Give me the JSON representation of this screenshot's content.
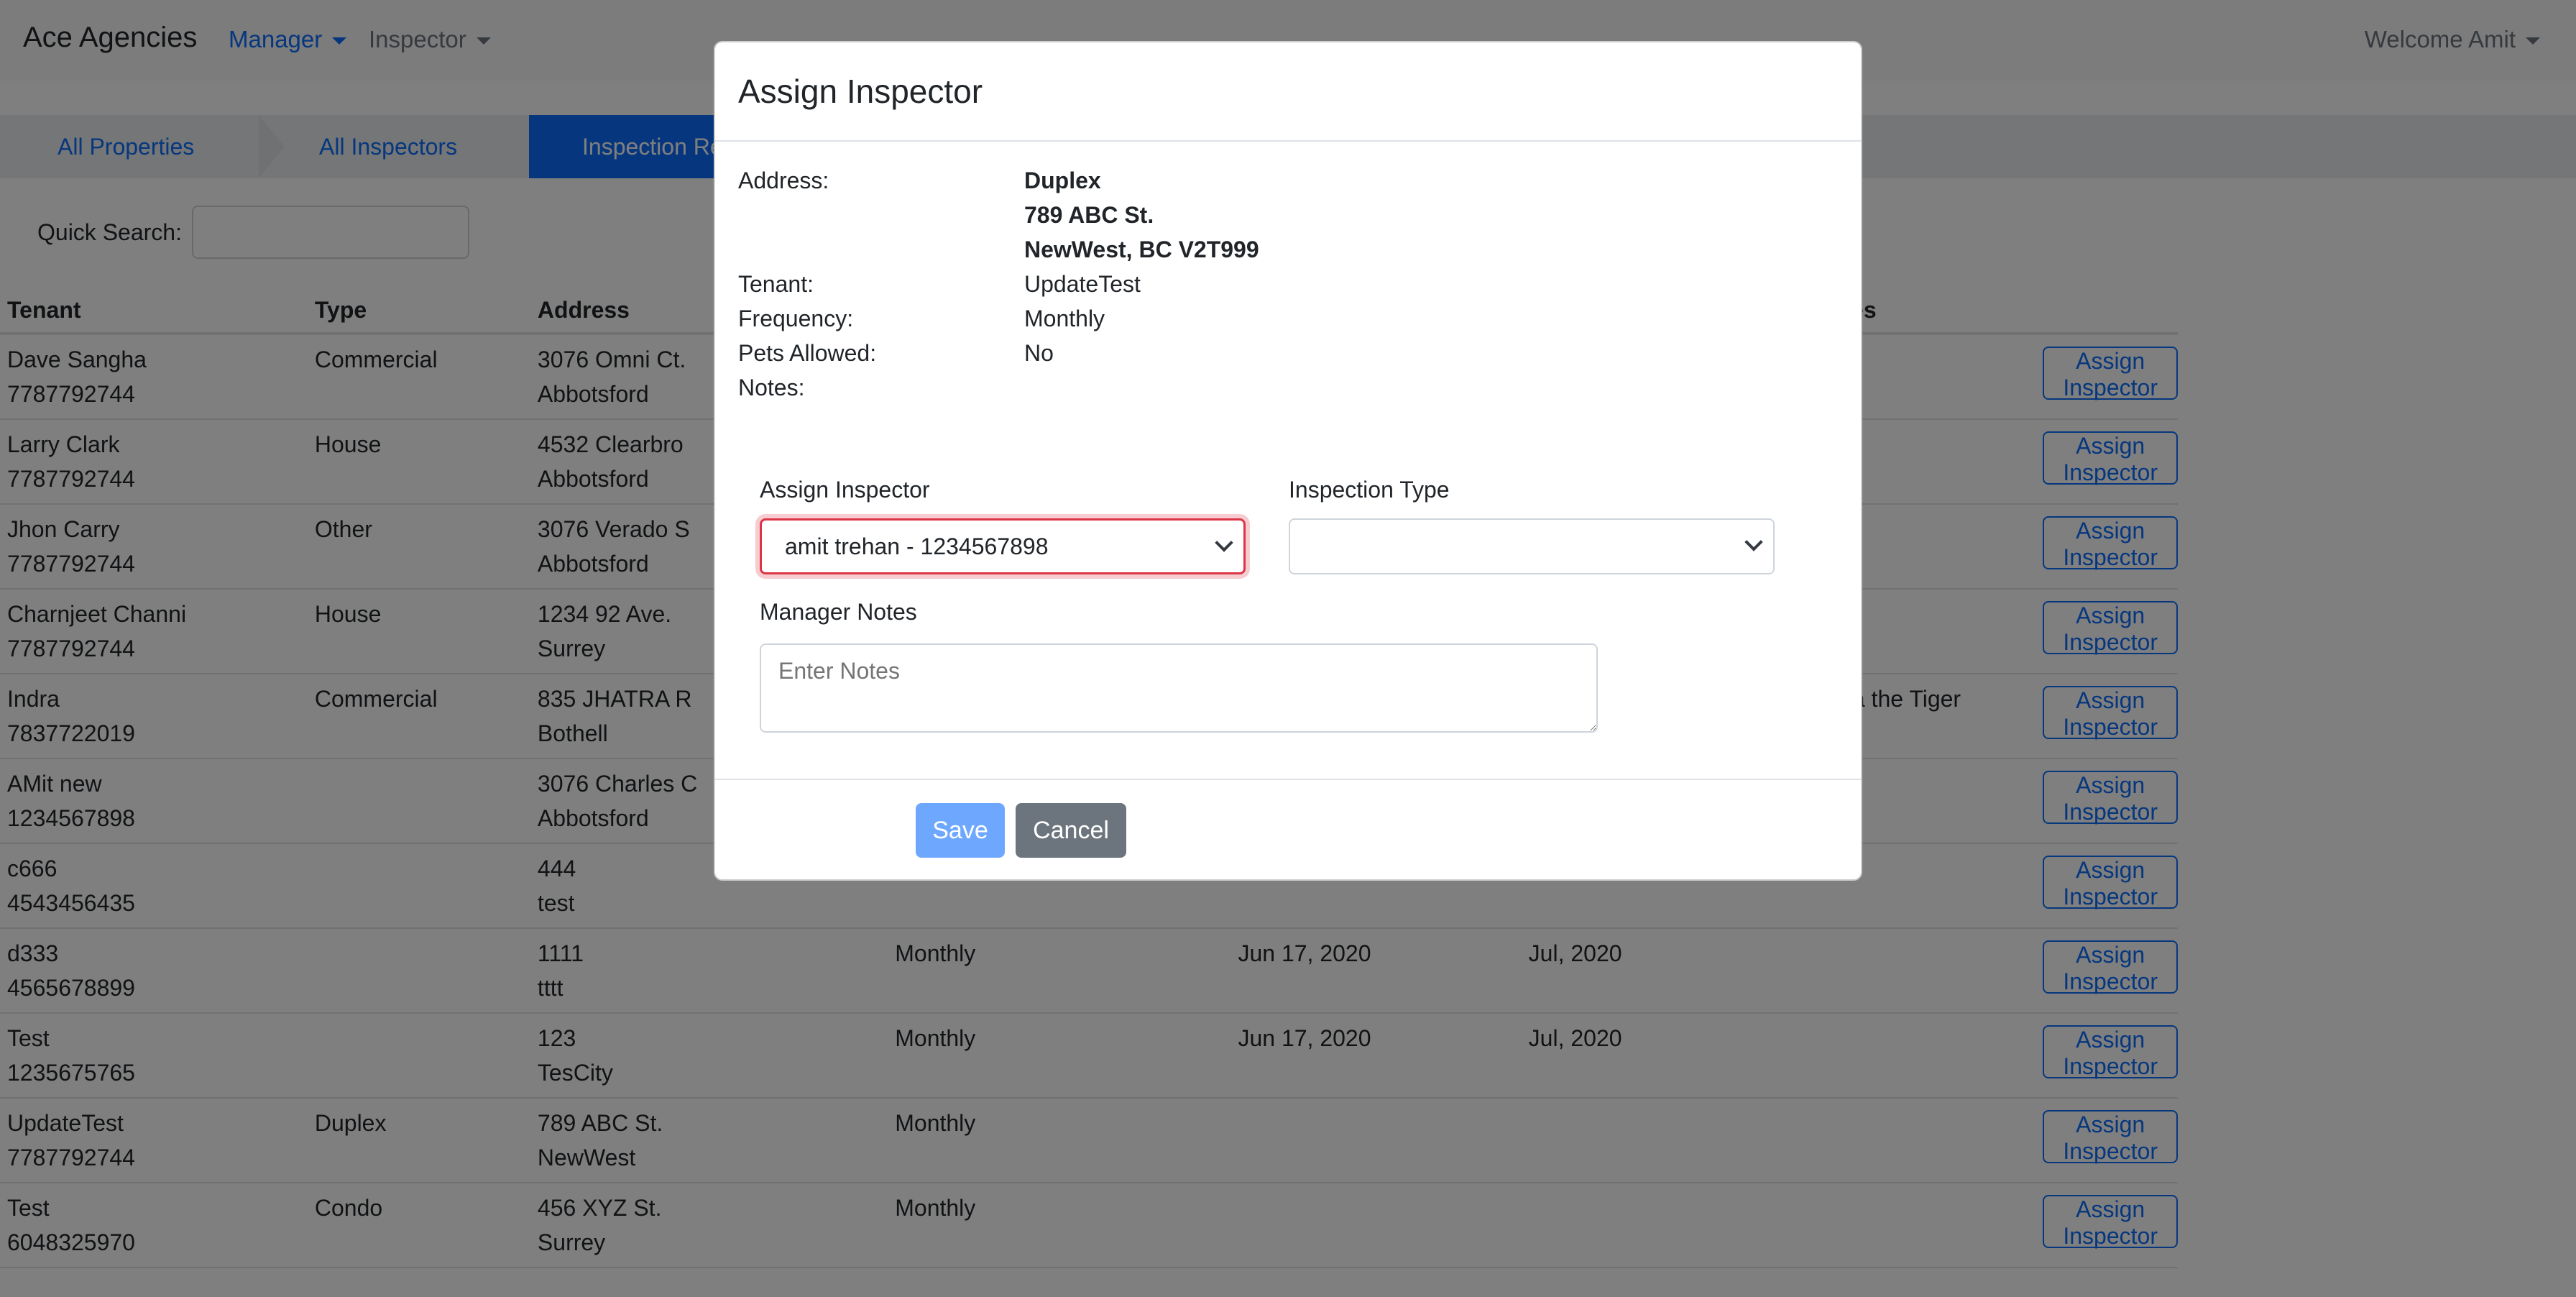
{
  "navbar": {
    "brand": "Ace Agencies",
    "menu_manager": "Manager",
    "menu_inspector": "Inspector",
    "welcome": "Welcome Amit"
  },
  "breadcrumb": {
    "items": [
      "All Properties",
      "All Inspectors",
      "Inspection Re"
    ]
  },
  "search": {
    "label": "Quick Search:",
    "value": ""
  },
  "table": {
    "headers": [
      "Tenant",
      "Type",
      "Address",
      "",
      "",
      "",
      "Notes",
      ""
    ],
    "rows": [
      {
        "tenant": "Dave Sangha",
        "phone": "7787792744",
        "type": "Commercial",
        "addr1": "3076 Omni Ct.",
        "addr2": "Abbotsford",
        "freq": "",
        "date1": "",
        "date2": "",
        "notes": "",
        "btn": "Assign Inspector"
      },
      {
        "tenant": "Larry Clark",
        "phone": "7787792744",
        "type": "House",
        "addr1": "4532 Clearbro",
        "addr2": "Abbotsford",
        "freq": "",
        "date1": "",
        "date2": "",
        "notes": "",
        "btn": "Assign Inspector"
      },
      {
        "tenant": "Jhon Carry",
        "phone": "7787792744",
        "type": "Other",
        "addr1": "3076 Verado S",
        "addr2": "Abbotsford",
        "freq": "",
        "date1": "",
        "date2": "",
        "notes": "",
        "btn": "Assign Inspector"
      },
      {
        "tenant": "Charnjeet Channi",
        "phone": "7787792744",
        "type": "House",
        "addr1": "1234 92 Ave.",
        "addr2": "Surrey",
        "freq": "",
        "date1": "",
        "date2": "",
        "notes": "",
        "btn": "Assign Inspector"
      },
      {
        "tenant": "Indra",
        "phone": "7837722019",
        "type": "Commercial",
        "addr1": "835 JHATRA R",
        "addr2": "Bothell",
        "freq": "",
        "date1": "",
        "date2": "",
        "notes": "Indra the Tiger",
        "btn": "Assign Inspector"
      },
      {
        "tenant": "AMit new",
        "phone": "1234567898",
        "type": "",
        "addr1": "3076 Charles C",
        "addr2": "Abbotsford",
        "freq": "",
        "date1": "",
        "date2": "",
        "notes": "",
        "btn": "Assign Inspector"
      },
      {
        "tenant": "c666",
        "phone": "4543456435",
        "type": "",
        "addr1": "444",
        "addr2": "test",
        "freq": "",
        "date1": "",
        "date2": "",
        "notes": "",
        "btn": "Assign Inspector"
      },
      {
        "tenant": "d333",
        "phone": "4565678899",
        "type": "",
        "addr1": "1111",
        "addr2": "tttt",
        "freq": "Monthly",
        "date1": "Jun 17, 2020",
        "date2": "Jul, 2020",
        "notes": "",
        "btn": "Assign Inspector"
      },
      {
        "tenant": "Test",
        "phone": "1235675765",
        "type": "",
        "addr1": "123",
        "addr2": "TesCity",
        "freq": "Monthly",
        "date1": "Jun 17, 2020",
        "date2": "Jul, 2020",
        "notes": "",
        "btn": "Assign Inspector"
      },
      {
        "tenant": "UpdateTest",
        "phone": "7787792744",
        "type": "Duplex",
        "addr1": "789 ABC St.",
        "addr2": "NewWest",
        "freq": "Monthly",
        "date1": "",
        "date2": "",
        "notes": "",
        "btn": "Assign Inspector"
      },
      {
        "tenant": "Test",
        "phone": "6048325970",
        "type": "Condo",
        "addr1": "456 XYZ St.",
        "addr2": "Surrey",
        "freq": "Monthly",
        "date1": "",
        "date2": "",
        "notes": "",
        "btn": "Assign Inspector"
      }
    ]
  },
  "modal": {
    "title": "Assign Inspector",
    "labels": {
      "address": "Address:",
      "tenant": "Tenant:",
      "frequency": "Frequency:",
      "pets": "Pets Allowed:",
      "notes": "Notes:"
    },
    "values": {
      "address_line1": "Duplex",
      "address_line2": "789 ABC St.",
      "address_line3": "NewWest, BC V2T999",
      "tenant": "UpdateTest",
      "frequency": "Monthly",
      "pets": "No",
      "notes": ""
    },
    "form": {
      "inspector_label": "Assign Inspector",
      "inspector_value": "amit trehan - 1234567898",
      "type_label": "Inspection Type",
      "type_value": "",
      "manager_notes_label": "Manager Notes",
      "manager_notes_placeholder": "Enter Notes"
    },
    "buttons": {
      "save": "Save",
      "cancel": "Cancel"
    }
  },
  "colors": {
    "primary": "#0d6efd",
    "save_disabled": "#6ea8fe",
    "cancel": "#6c757d",
    "invalid": "#dc3545"
  }
}
